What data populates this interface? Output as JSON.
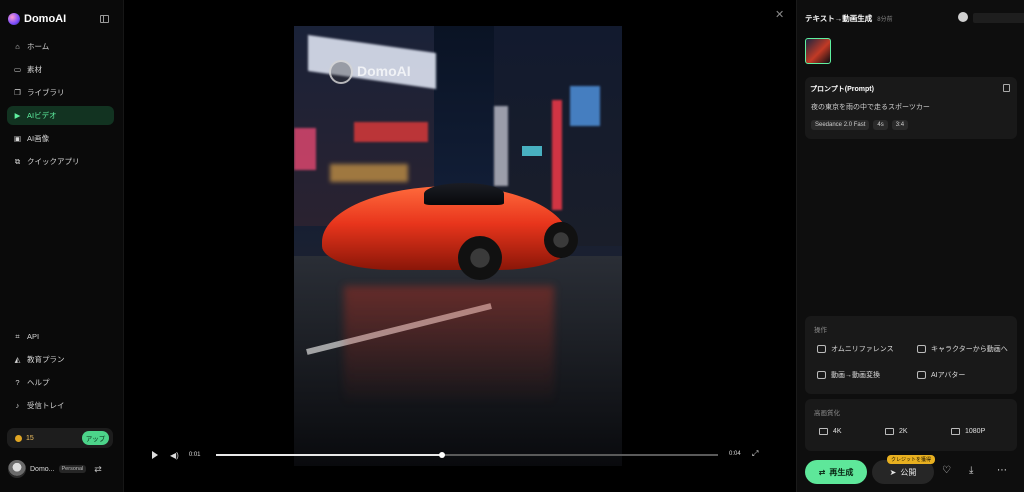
{
  "brand": {
    "name": "DomoAI"
  },
  "sidebar": {
    "items": [
      {
        "label": "ホーム",
        "icon": "home-icon",
        "glyph": "⌂"
      },
      {
        "label": "素材",
        "icon": "assets-icon",
        "glyph": "▭"
      },
      {
        "label": "ライブラリ",
        "icon": "library-icon",
        "glyph": "❐"
      },
      {
        "label": "AIビデオ",
        "icon": "video-icon",
        "glyph": "▶"
      },
      {
        "label": "AI画像",
        "icon": "image-icon",
        "glyph": "▣"
      },
      {
        "label": "クイックアプリ",
        "icon": "apps-icon",
        "glyph": "⧉"
      }
    ],
    "bottom_items": [
      {
        "label": "API",
        "icon": "api-icon",
        "glyph": "⌗"
      },
      {
        "label": "教育プラン",
        "icon": "education-icon",
        "glyph": "◭"
      },
      {
        "label": "ヘルプ",
        "icon": "help-icon",
        "glyph": "?"
      },
      {
        "label": "受信トレイ",
        "icon": "bell-icon",
        "glyph": "♪"
      }
    ],
    "credits": "15",
    "upgrade_label": "アップ",
    "user_name": "Domo...",
    "plan": "Personal"
  },
  "viewer": {
    "watermark": "DomoAI",
    "time_current": "0:01",
    "time_total": "0:04",
    "progress": 0.45
  },
  "panel": {
    "title": "テキスト→動画生成",
    "time_ago": "8分前",
    "prompt_title": "プロンプト(Prompt)",
    "prompt_text": "夜の東京を雨の中で走るスポーツカー",
    "tags": [
      "Seedance 2.0 Fast",
      "4s",
      "3:4"
    ],
    "ops_label": "操作",
    "ops": [
      "オムニリファレンス",
      "キャラクターから動画へ",
      "動画→動画変換",
      "AIアバター"
    ],
    "upscale_label": "高画質化",
    "resolutions": [
      "4K",
      "2K",
      "1080P"
    ],
    "regen_label": "再生成",
    "publish_label": "公開",
    "credit_badge": "クレジットを獲得"
  },
  "colors": {
    "accent": "#5ee79a",
    "active_bg": "#123321",
    "badge": "#e8b020"
  }
}
